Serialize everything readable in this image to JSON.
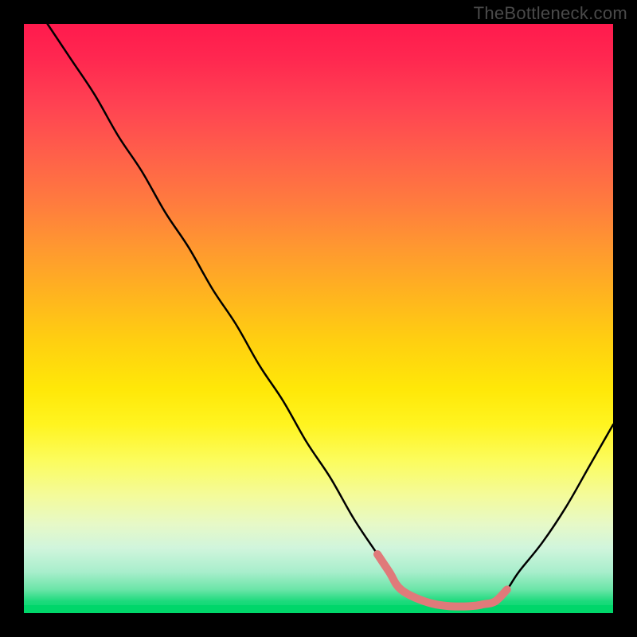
{
  "watermark": "TheBottleneck.com",
  "chart_data": {
    "type": "line",
    "title": "",
    "xlabel": "",
    "ylabel": "",
    "xlim": [
      0,
      100
    ],
    "ylim": [
      0,
      100
    ],
    "grid": false,
    "series": [
      {
        "name": "bottleneck-curve-black",
        "stroke": "#000000",
        "x": [
          4,
          8,
          12,
          16,
          20,
          24,
          28,
          32,
          36,
          40,
          44,
          48,
          52,
          56,
          60,
          62,
          64,
          68,
          72,
          76,
          78,
          80,
          82,
          84,
          88,
          92,
          96,
          100
        ],
        "y": [
          100,
          94,
          88,
          81,
          75,
          68,
          62,
          55,
          49,
          42,
          36,
          29,
          23,
          16,
          10,
          7,
          4,
          2,
          1.2,
          1.2,
          1.5,
          2,
          4,
          7,
          12,
          18,
          25,
          32
        ]
      },
      {
        "name": "bottleneck-curve-red-accent",
        "stroke": "#e07a7a",
        "x": [
          60,
          62,
          64,
          68,
          72,
          76,
          78,
          80,
          82
        ],
        "y": [
          10,
          7,
          4,
          2,
          1.2,
          1.2,
          1.5,
          2,
          4
        ]
      }
    ],
    "colors": {
      "gradient_top": "#ff1a4d",
      "gradient_mid": "#ffe808",
      "gradient_bottom": "#00d66a",
      "curve": "#000000",
      "accent": "#e07a7a",
      "frame": "#000000"
    }
  }
}
